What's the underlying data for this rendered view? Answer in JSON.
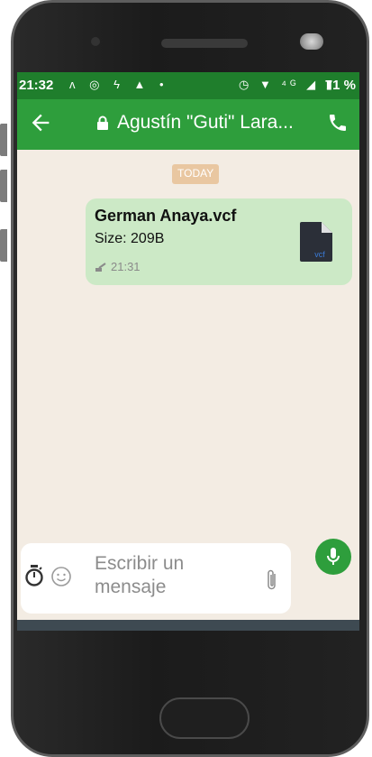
{
  "status_bar": {
    "time": "21:32",
    "left_icons": "ᴧ ◎ ϟ ▲ •",
    "right_icons": "◷ ▼ ⁴ᴳ ◢ ▮",
    "battery": "71 %"
  },
  "app_bar": {
    "contact_name": "Agustín \"Guti\" Lara..."
  },
  "chat": {
    "date_chip": "TODAY",
    "message": {
      "file_name": "German Anaya.vcf",
      "file_size": "Size: 209B",
      "time": "21:31",
      "file_type": "vcf"
    }
  },
  "composer": {
    "placeholder": "Escribir un mensaje"
  },
  "colors": {
    "status_bar": "#1f7e2c",
    "app_bar": "#2e9e3c",
    "chat_background": "#f3ece3",
    "bubble": "#cce9c6",
    "date_chip": "#e9c7a1",
    "nav_bar": "#3e4a52"
  },
  "icons": {
    "back": "back-arrow-icon",
    "lock": "lock-icon",
    "call": "phone-icon",
    "file": "document-icon",
    "timer": "timer-icon",
    "emoji": "emoji-icon",
    "attach": "paperclip-icon",
    "mic": "microphone-icon"
  }
}
